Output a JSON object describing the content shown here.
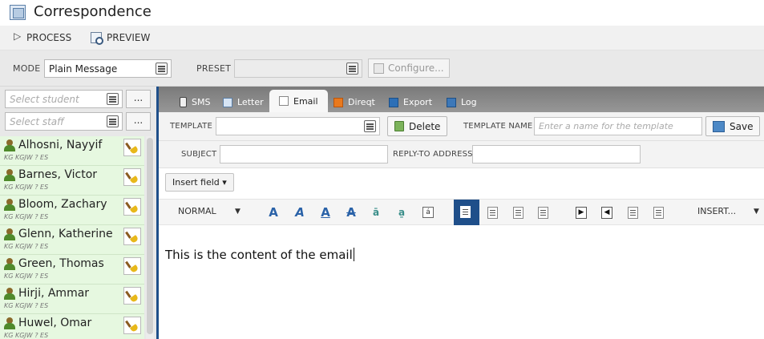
{
  "app": {
    "title": "Correspondence"
  },
  "actions": {
    "process": "PROCESS",
    "preview": "PREVIEW"
  },
  "mode_bar": {
    "mode_label": "MODE",
    "mode_value": "Plain Message",
    "preset_label": "PRESET",
    "preset_value": "",
    "configure_label": "Configure..."
  },
  "left_panel": {
    "student_placeholder": "Select student",
    "staff_placeholder": "Select staff",
    "browse_label": "...",
    "students": [
      {
        "name": "Alhosni, Nayyif",
        "sub": "KG KGJW ? ES"
      },
      {
        "name": "Barnes, Victor",
        "sub": "KG KGJW ? ES"
      },
      {
        "name": "Bloom, Zachary",
        "sub": "KG KGJW ? ES"
      },
      {
        "name": "Glenn, Katherine",
        "sub": "KG KGJW ? ES"
      },
      {
        "name": "Green, Thomas",
        "sub": "KG KGJW ? ES"
      },
      {
        "name": "Hirji, Ammar",
        "sub": "KG KGJW ? ES"
      },
      {
        "name": "Huwel, Omar",
        "sub": "KG KGJW ? ES"
      }
    ]
  },
  "tabs": [
    {
      "label": "SMS",
      "icon": "phone-icon"
    },
    {
      "label": "Letter",
      "icon": "letter-icon"
    },
    {
      "label": "Email",
      "icon": "email-icon",
      "active": true
    },
    {
      "label": "Direqt",
      "icon": "direqt-icon"
    },
    {
      "label": "Export",
      "icon": "export-icon"
    },
    {
      "label": "Log",
      "icon": "log-icon"
    }
  ],
  "email": {
    "template_label": "TEMPLATE",
    "template_value": "",
    "delete_label": "Delete",
    "template_name_label": "TEMPLATE NAME",
    "template_name_placeholder": "Enter a name for the template",
    "save_label": "Save",
    "subject_label": "SUBJECT",
    "subject_value": "",
    "reply_to_label": "REPLY-TO ADDRESS",
    "reply_to_value": "",
    "insert_field_label": "Insert field ▾",
    "format_label": "NORMAL",
    "insert_menu_label": "INSERT...",
    "content": "This is the content of the email"
  },
  "colors": {
    "accent": "#1f4f8a",
    "student_row_bg": "#e6f8e0",
    "tab_strip": "#8a8a8a"
  }
}
